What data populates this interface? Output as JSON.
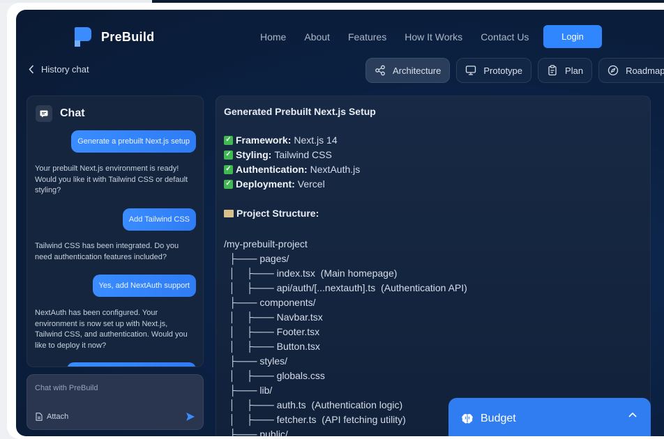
{
  "brand": {
    "name": "PreBuild"
  },
  "nav": {
    "items": [
      "Home",
      "About",
      "Features",
      "How It Works",
      "Contact Us"
    ],
    "login": "Login"
  },
  "history": {
    "label": "History chat"
  },
  "tabs": [
    {
      "label": "Architecture",
      "icon": "share-nodes-icon",
      "active": true
    },
    {
      "label": "Prototype",
      "icon": "monitor-icon",
      "active": false
    },
    {
      "label": "Plan",
      "icon": "clipboard-icon",
      "active": false
    },
    {
      "label": "Roadmap",
      "icon": "compass-icon",
      "active": false
    }
  ],
  "chat": {
    "title": "Chat",
    "messages": [
      {
        "role": "user",
        "text": "Generate a prebuilt Next.js setup"
      },
      {
        "role": "bot",
        "text": "Your prebuilt Next.js environment is ready! Would you like it with Tailwind CSS or default styling?"
      },
      {
        "role": "user",
        "text": "Add Tailwind CSS"
      },
      {
        "role": "bot",
        "text": "Tailwind CSS has been integrated. Do you need authentication features included?"
      },
      {
        "role": "user",
        "text": "Yes, add NextAuth support"
      },
      {
        "role": "bot",
        "text": "NextAuth has been configured. Your environment is now set up with Next.js, Tailwind CSS, and authentication. Would you like to deploy it now?"
      }
    ],
    "input_placeholder": "Chat with PreBuild",
    "attach_label": "Attach"
  },
  "content": {
    "title": "Generated Prebuilt Next.js Setup",
    "features": [
      {
        "key": "Framework:",
        "value": "Next.js 14"
      },
      {
        "key": "Styling:",
        "value": "Tailwind CSS"
      },
      {
        "key": "Authentication:",
        "value": "NextAuth.js"
      },
      {
        "key": "Deployment:",
        "value": "Vercel"
      }
    ],
    "structure_title": "Project Structure:",
    "tree": [
      "/my-prebuilt-project",
      "  ├─── pages/",
      "  │    ├─── index.tsx  (Main homepage)",
      "  │    ├─── api/auth/[...nextauth].ts  (Authentication API)",
      "  ├─── components/",
      "  │    ├─── Navbar.tsx",
      "  │    ├─── Footer.tsx",
      "  │    ├─── Button.tsx",
      "  ├─── styles/",
      "  │    ├─── globals.css",
      "  ├─── lib/",
      "  │    ├─── auth.ts  (Authentication logic)",
      "  │    ├─── fetcher.ts  (API fetching utility)",
      "  ├─── public/"
    ]
  },
  "budget": {
    "label": "Budget"
  }
}
